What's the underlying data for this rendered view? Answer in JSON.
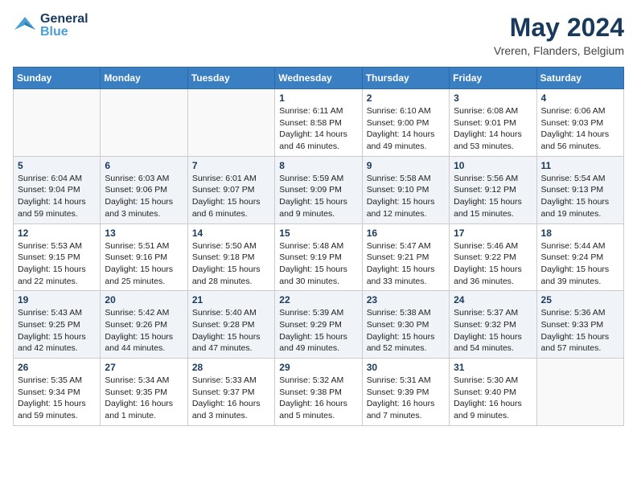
{
  "header": {
    "logo_general": "General",
    "logo_blue": "Blue",
    "title": "May 2024",
    "subtitle": "Vreren, Flanders, Belgium"
  },
  "days_of_week": [
    "Sunday",
    "Monday",
    "Tuesday",
    "Wednesday",
    "Thursday",
    "Friday",
    "Saturday"
  ],
  "weeks": [
    {
      "days": [
        {
          "num": "",
          "info": ""
        },
        {
          "num": "",
          "info": ""
        },
        {
          "num": "",
          "info": ""
        },
        {
          "num": "1",
          "info": "Sunrise: 6:11 AM\nSunset: 8:58 PM\nDaylight: 14 hours\nand 46 minutes."
        },
        {
          "num": "2",
          "info": "Sunrise: 6:10 AM\nSunset: 9:00 PM\nDaylight: 14 hours\nand 49 minutes."
        },
        {
          "num": "3",
          "info": "Sunrise: 6:08 AM\nSunset: 9:01 PM\nDaylight: 14 hours\nand 53 minutes."
        },
        {
          "num": "4",
          "info": "Sunrise: 6:06 AM\nSunset: 9:03 PM\nDaylight: 14 hours\nand 56 minutes."
        }
      ]
    },
    {
      "days": [
        {
          "num": "5",
          "info": "Sunrise: 6:04 AM\nSunset: 9:04 PM\nDaylight: 14 hours\nand 59 minutes."
        },
        {
          "num": "6",
          "info": "Sunrise: 6:03 AM\nSunset: 9:06 PM\nDaylight: 15 hours\nand 3 minutes."
        },
        {
          "num": "7",
          "info": "Sunrise: 6:01 AM\nSunset: 9:07 PM\nDaylight: 15 hours\nand 6 minutes."
        },
        {
          "num": "8",
          "info": "Sunrise: 5:59 AM\nSunset: 9:09 PM\nDaylight: 15 hours\nand 9 minutes."
        },
        {
          "num": "9",
          "info": "Sunrise: 5:58 AM\nSunset: 9:10 PM\nDaylight: 15 hours\nand 12 minutes."
        },
        {
          "num": "10",
          "info": "Sunrise: 5:56 AM\nSunset: 9:12 PM\nDaylight: 15 hours\nand 15 minutes."
        },
        {
          "num": "11",
          "info": "Sunrise: 5:54 AM\nSunset: 9:13 PM\nDaylight: 15 hours\nand 19 minutes."
        }
      ]
    },
    {
      "days": [
        {
          "num": "12",
          "info": "Sunrise: 5:53 AM\nSunset: 9:15 PM\nDaylight: 15 hours\nand 22 minutes."
        },
        {
          "num": "13",
          "info": "Sunrise: 5:51 AM\nSunset: 9:16 PM\nDaylight: 15 hours\nand 25 minutes."
        },
        {
          "num": "14",
          "info": "Sunrise: 5:50 AM\nSunset: 9:18 PM\nDaylight: 15 hours\nand 28 minutes."
        },
        {
          "num": "15",
          "info": "Sunrise: 5:48 AM\nSunset: 9:19 PM\nDaylight: 15 hours\nand 30 minutes."
        },
        {
          "num": "16",
          "info": "Sunrise: 5:47 AM\nSunset: 9:21 PM\nDaylight: 15 hours\nand 33 minutes."
        },
        {
          "num": "17",
          "info": "Sunrise: 5:46 AM\nSunset: 9:22 PM\nDaylight: 15 hours\nand 36 minutes."
        },
        {
          "num": "18",
          "info": "Sunrise: 5:44 AM\nSunset: 9:24 PM\nDaylight: 15 hours\nand 39 minutes."
        }
      ]
    },
    {
      "days": [
        {
          "num": "19",
          "info": "Sunrise: 5:43 AM\nSunset: 9:25 PM\nDaylight: 15 hours\nand 42 minutes."
        },
        {
          "num": "20",
          "info": "Sunrise: 5:42 AM\nSunset: 9:26 PM\nDaylight: 15 hours\nand 44 minutes."
        },
        {
          "num": "21",
          "info": "Sunrise: 5:40 AM\nSunset: 9:28 PM\nDaylight: 15 hours\nand 47 minutes."
        },
        {
          "num": "22",
          "info": "Sunrise: 5:39 AM\nSunset: 9:29 PM\nDaylight: 15 hours\nand 49 minutes."
        },
        {
          "num": "23",
          "info": "Sunrise: 5:38 AM\nSunset: 9:30 PM\nDaylight: 15 hours\nand 52 minutes."
        },
        {
          "num": "24",
          "info": "Sunrise: 5:37 AM\nSunset: 9:32 PM\nDaylight: 15 hours\nand 54 minutes."
        },
        {
          "num": "25",
          "info": "Sunrise: 5:36 AM\nSunset: 9:33 PM\nDaylight: 15 hours\nand 57 minutes."
        }
      ]
    },
    {
      "days": [
        {
          "num": "26",
          "info": "Sunrise: 5:35 AM\nSunset: 9:34 PM\nDaylight: 15 hours\nand 59 minutes."
        },
        {
          "num": "27",
          "info": "Sunrise: 5:34 AM\nSunset: 9:35 PM\nDaylight: 16 hours\nand 1 minute."
        },
        {
          "num": "28",
          "info": "Sunrise: 5:33 AM\nSunset: 9:37 PM\nDaylight: 16 hours\nand 3 minutes."
        },
        {
          "num": "29",
          "info": "Sunrise: 5:32 AM\nSunset: 9:38 PM\nDaylight: 16 hours\nand 5 minutes."
        },
        {
          "num": "30",
          "info": "Sunrise: 5:31 AM\nSunset: 9:39 PM\nDaylight: 16 hours\nand 7 minutes."
        },
        {
          "num": "31",
          "info": "Sunrise: 5:30 AM\nSunset: 9:40 PM\nDaylight: 16 hours\nand 9 minutes."
        },
        {
          "num": "",
          "info": ""
        }
      ]
    }
  ]
}
